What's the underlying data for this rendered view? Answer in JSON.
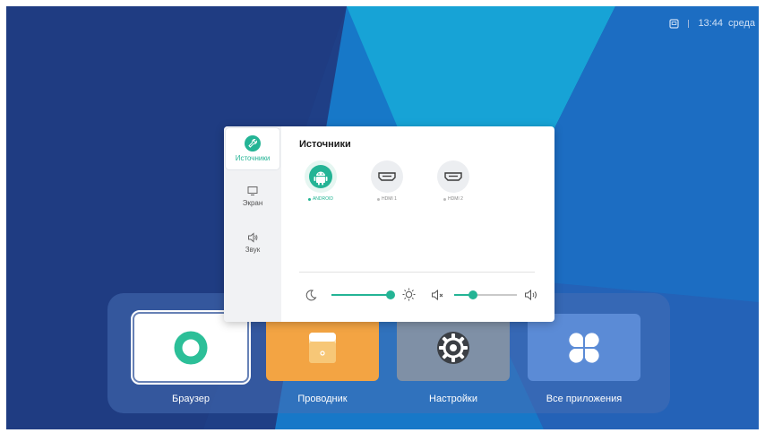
{
  "status_bar": {
    "time": "13:44",
    "day": "среда"
  },
  "dock": {
    "apps": [
      {
        "label": "Браузер",
        "icon": "browser-ring-icon"
      },
      {
        "label": "Проводник",
        "icon": "folder-icon"
      },
      {
        "label": "Настройки",
        "icon": "gear-icon"
      },
      {
        "label": "Все приложения",
        "icon": "four-petal-icon"
      }
    ]
  },
  "panel": {
    "title": "Источники",
    "sidebar": [
      {
        "label": "Источники",
        "icon": "wrench-icon",
        "active": true
      },
      {
        "label": "Экран",
        "icon": "monitor-icon"
      },
      {
        "label": "Звук",
        "icon": "speaker-icon"
      }
    ],
    "sources": [
      {
        "label": "ANDROID",
        "icon": "android-icon",
        "active": true
      },
      {
        "label": "HDMI 1",
        "icon": "hdmi-icon"
      },
      {
        "label": "HDMI 2",
        "icon": "hdmi-icon"
      }
    ],
    "brightness": {
      "value": 1.0,
      "icon_low": "moon-icon",
      "icon_high": "sun-icon"
    },
    "volume": {
      "value": 0.3,
      "icon_low": "mute-icon",
      "icon_high": "volume-icon"
    }
  },
  "colors": {
    "accent": "#24b495",
    "background_dark": "#1f3f86",
    "background_light": "#1a9fd8"
  }
}
